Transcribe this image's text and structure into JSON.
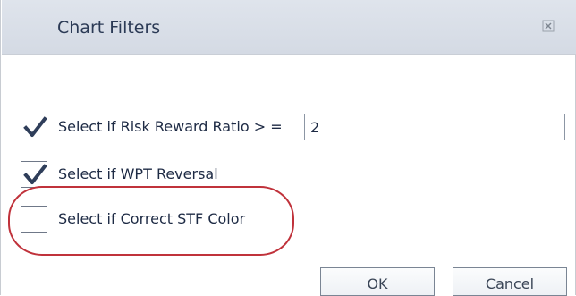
{
  "dialog": {
    "title": "Chart Filters",
    "close_icon": "close-icon"
  },
  "filters": [
    {
      "label": "Select if Risk Reward Ratio > =",
      "checked": true,
      "value": "2"
    },
    {
      "label": "Select if WPT Reversal",
      "checked": true
    },
    {
      "label": "Select if Correct STF Color",
      "checked": false
    }
  ],
  "buttons": {
    "ok_label": "OK",
    "cancel_label": "Cancel"
  },
  "colors": {
    "titlebar": "#d8dee7",
    "checkmark": "#2f3e5a",
    "highlight": "#c0323b"
  }
}
